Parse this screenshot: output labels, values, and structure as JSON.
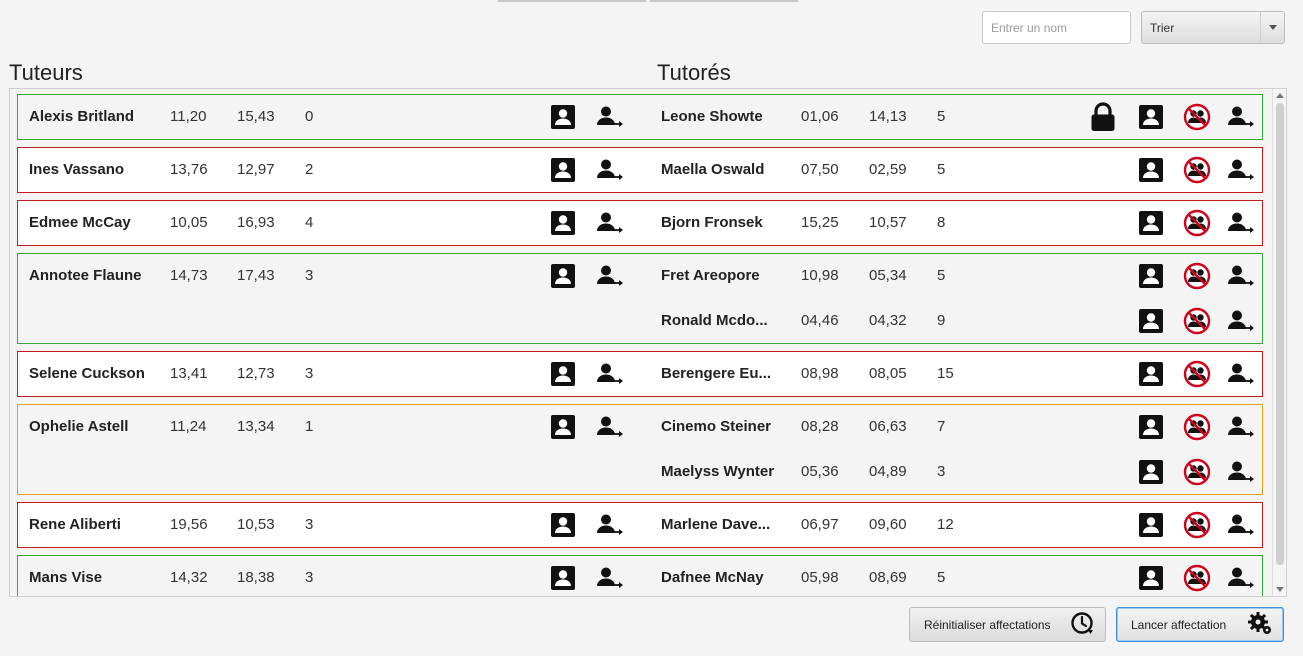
{
  "search": {
    "placeholder": "Entrer un nom"
  },
  "sort": {
    "label": "Trier"
  },
  "sections": {
    "tutors_title": "Tuteurs",
    "tutees_title": "Tutorés"
  },
  "groups": [
    {
      "status": "green",
      "tutor": {
        "name": "Alexis Britland",
        "v1": "11,20",
        "v2": "15,43",
        "v3": "0"
      },
      "tutees": [
        {
          "name": "Leone Showte",
          "v1": "01,06",
          "v2": "14,13",
          "v3": "5",
          "locked": true
        }
      ]
    },
    {
      "status": "red",
      "tutor": {
        "name": "Ines Vassano",
        "v1": "13,76",
        "v2": "12,97",
        "v3": "2"
      },
      "tutees": [
        {
          "name": "Maella Oswald",
          "v1": "07,50",
          "v2": "02,59",
          "v3": "5"
        }
      ]
    },
    {
      "status": "red",
      "tutor": {
        "name": "Edmee McCay",
        "v1": "10,05",
        "v2": "16,93",
        "v3": "4"
      },
      "tutees": [
        {
          "name": "Bjorn Fronsek",
          "v1": "15,25",
          "v2": "10,57",
          "v3": "8"
        }
      ]
    },
    {
      "status": "green",
      "tutor": {
        "name": "Annotee Flaune",
        "v1": "14,73",
        "v2": "17,43",
        "v3": "3"
      },
      "tutees": [
        {
          "name": "Fret Areopore",
          "v1": "10,98",
          "v2": "05,34",
          "v3": "5"
        },
        {
          "name": "Ronald Mcdo...",
          "v1": "04,46",
          "v2": "04,32",
          "v3": "9"
        }
      ]
    },
    {
      "status": "red",
      "tutor": {
        "name": "Selene Cuckson",
        "v1": "13,41",
        "v2": "12,73",
        "v3": "3"
      },
      "tutees": [
        {
          "name": "Berengere Eu...",
          "v1": "08,98",
          "v2": "08,05",
          "v3": "15"
        }
      ]
    },
    {
      "status": "orange",
      "tutor": {
        "name": "Ophelie Astell",
        "v1": "11,24",
        "v2": "13,34",
        "v3": "1"
      },
      "tutees": [
        {
          "name": "Cinemo Steiner",
          "v1": "08,28",
          "v2": "06,63",
          "v3": "7"
        },
        {
          "name": "Maelyss Wynter",
          "v1": "05,36",
          "v2": "04,89",
          "v3": "3"
        }
      ]
    },
    {
      "status": "red",
      "tutor": {
        "name": "Rene Aliberti",
        "v1": "19,56",
        "v2": "10,53",
        "v3": "3"
      },
      "tutees": [
        {
          "name": "Marlene Dave...",
          "v1": "06,97",
          "v2": "09,60",
          "v3": "12"
        }
      ]
    },
    {
      "status": "green",
      "tutor": {
        "name": "Mans Vise",
        "v1": "14,32",
        "v2": "18,38",
        "v3": "3"
      },
      "tutees": [
        {
          "name": "Dafnee McNay",
          "v1": "05,98",
          "v2": "08,69",
          "v3": "5"
        }
      ]
    }
  ],
  "buttons": {
    "reset": "Réinitialiser affectations",
    "launch": "Lancer affectation"
  },
  "colors": {
    "green": "#3aa63a",
    "red": "#c41b1b",
    "orange": "#e0a21e",
    "forbid": "#d0021b"
  },
  "icons": {
    "profile": "profile-card-icon",
    "assign": "person-arrow-icon",
    "forbid": "forbid-pair-icon",
    "lock": "lock-icon",
    "reset": "history-icon",
    "launch": "gear-icon"
  }
}
